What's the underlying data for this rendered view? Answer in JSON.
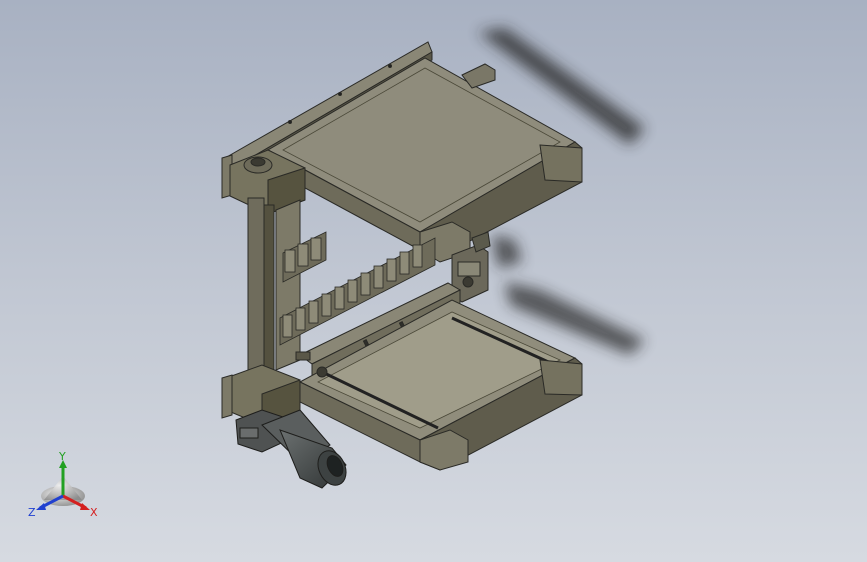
{
  "viewport": {
    "background_top": "#a8b1c2",
    "background_bottom": "#d6dae1"
  },
  "model": {
    "body_color": "#7d7a68",
    "body_shadow_color": "#5a5748",
    "top_surface_color": "#8f8c7c",
    "edge_color": "#2a2a26"
  },
  "triad": {
    "axis_x": {
      "label": "X",
      "color": "#d42020"
    },
    "axis_y": {
      "label": "Y",
      "color": "#22a022"
    },
    "axis_z": {
      "label": "Z",
      "color": "#2040d0"
    }
  }
}
